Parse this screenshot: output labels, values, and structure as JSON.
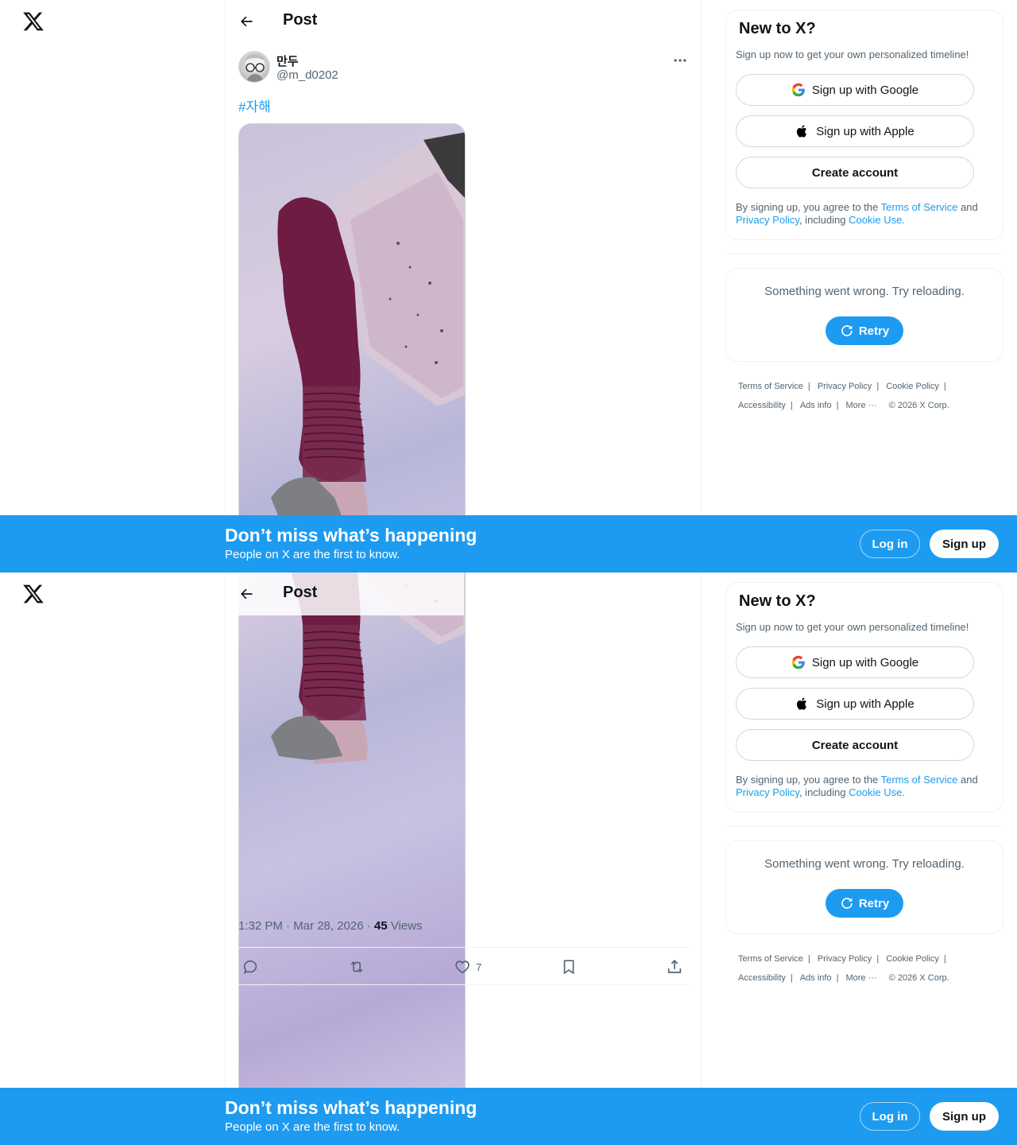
{
  "app": {
    "logo": "x-logo-icon"
  },
  "post": {
    "header_title": "Post",
    "author_name": "만두",
    "author_handle": "@m_d0202",
    "text": "#자해",
    "time": "1:32 PM · Mar 28, 2026 · ",
    "views_count": "45",
    "views_label": " Views",
    "likes": "7"
  },
  "signup": {
    "title": "New to X?",
    "subtitle": "Sign up now to get your own personalized timeline!",
    "google": "Sign up with Google",
    "apple": "Sign up with Apple",
    "create": "Create account",
    "legal_1": "By signing up, you agree to the ",
    "terms": "Terms of Service",
    "legal_2": " and ",
    "privacy": "Privacy Policy",
    "legal_3": ", including ",
    "cookie": "Cookie Use."
  },
  "error": {
    "text": "Something went wrong. Try reloading.",
    "retry": "Retry"
  },
  "footer": {
    "terms": "Terms of Service",
    "privacy": "Privacy Policy",
    "cookie": "Cookie Policy",
    "accessibility": "Accessibility",
    "ads": "Ads info",
    "more": "More ···",
    "copyright": "© 2026 X Corp."
  },
  "banner": {
    "title": "Don’t miss what’s happening",
    "subtitle": "People on X are the first to know.",
    "login": "Log in",
    "signup": "Sign up"
  },
  "colors": {
    "accent": "#1d9bf0",
    "text": "#0f1419",
    "muted": "#536471"
  }
}
